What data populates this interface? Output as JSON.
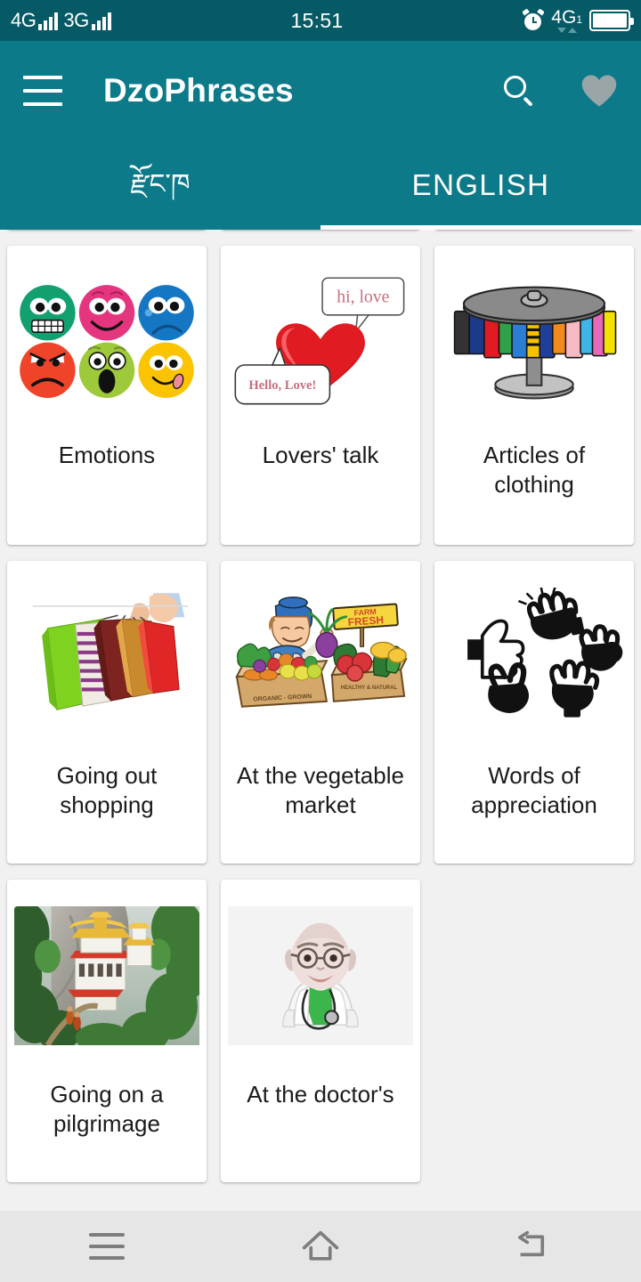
{
  "status_bar": {
    "sim1_network": "4G",
    "sim2_network": "3G",
    "clock": "15:51",
    "alarm_icon": "alarm-clock-icon",
    "data_network": "4G",
    "data_network_sub": "1",
    "battery_icon": "battery-icon"
  },
  "app_bar": {
    "menu_icon": "hamburger-menu-icon",
    "title": "DzoPhrases",
    "search_icon": "search-icon",
    "favorites_icon": "heart-icon",
    "accent_color": "#0d7a8a",
    "status_bar_color": "#065a66",
    "favorites_icon_color": "#9aa5a8"
  },
  "tabs": {
    "items": [
      {
        "label": "རྫོང་ཁ",
        "name": "tab-dzongkha",
        "active": false
      },
      {
        "label": "ENGLISH",
        "name": "tab-english",
        "active": true
      }
    ],
    "active_index": 1,
    "indicator_color": "#ffffff"
  },
  "grid": {
    "partial_row_above": [
      {
        "name": "card-stub-1"
      },
      {
        "name": "card-stub-2"
      },
      {
        "name": "card-stub-3"
      }
    ],
    "cards": [
      {
        "label": "Emotions",
        "art": "emotions",
        "name": "card-emotions"
      },
      {
        "label": "Lovers' talk",
        "art": "lovers",
        "name": "card-lovers-talk"
      },
      {
        "label": "Articles of clothing",
        "art": "clothing",
        "name": "card-articles-of-clothing"
      },
      {
        "label": "Going out shopping",
        "art": "shopping",
        "name": "card-going-out-shopping"
      },
      {
        "label": "At the vegetable market",
        "art": "market",
        "name": "card-at-the-vegetable-market"
      },
      {
        "label": "Words of appreciation",
        "art": "appreciation",
        "name": "card-words-of-appreciation"
      },
      {
        "label": "Going on a pilgrimage",
        "art": "pilgrimage",
        "name": "card-going-on-a-pilgrimage"
      },
      {
        "label": "At the doctor's",
        "art": "doctor",
        "name": "card-at-the-doctors"
      }
    ]
  },
  "art_text": {
    "lovers_bubble_top": "hi, love",
    "lovers_bubble_bottom": "Hello, Love!",
    "market_sign_line1": "FARM",
    "market_sign_line2": "FRESH",
    "market_crate_label": "ORGANIC - GROWN"
  },
  "nav_bar": {
    "recents_icon": "recents-icon",
    "home_icon": "home-icon",
    "back_icon": "back-icon",
    "background": "#e6e6e6",
    "icon_color": "#7d7d7d"
  }
}
